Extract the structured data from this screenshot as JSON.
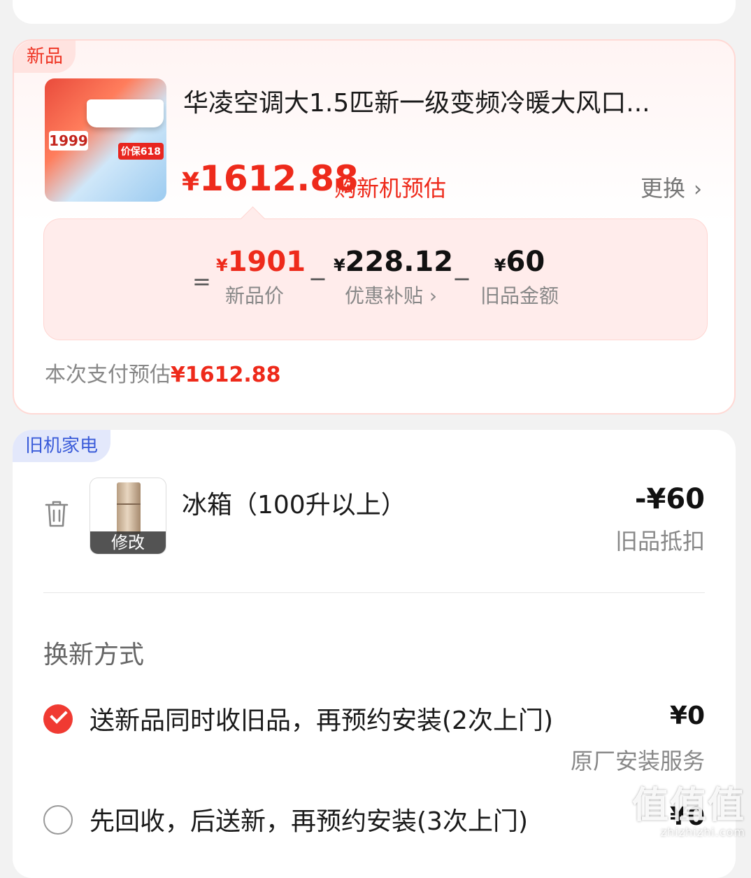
{
  "new_item": {
    "tag": "新品",
    "title": "华凌空调大1.5匹新一级变频冷暖大风口...",
    "thumb_price": "1999",
    "thumb_badge": "价保618",
    "price_yen": "¥",
    "price": "1612.88",
    "price_note": "购新机预估",
    "change_label": "更换",
    "calc": {
      "eq": "=",
      "minus": "−",
      "new_price_yen": "¥",
      "new_price": "1901",
      "new_price_label": "新品价",
      "subsidy_yen": "¥",
      "subsidy": "228.12",
      "subsidy_label": "优惠补贴",
      "subsidy_chevron": "›",
      "old_yen": "¥",
      "old_amount": "60",
      "old_label": "旧品金额"
    },
    "pay_estimate_label": "本次支付预估",
    "pay_estimate_value": "¥1612.88"
  },
  "old_item": {
    "tag": "旧机家电",
    "name": "冰箱（100升以上）",
    "edit_label": "修改",
    "deduction": "-¥60",
    "deduction_label": "旧品抵扣"
  },
  "method": {
    "title": "换新方式",
    "options": [
      {
        "label": "送新品同时收旧品，再预约安装(2次上门)",
        "price": "¥0",
        "sub": "原厂安装服务",
        "selected": true
      },
      {
        "label": "先回收，后送新，再预约安装(3次上门)",
        "price": "¥0",
        "selected": false
      }
    ]
  },
  "watermark": {
    "big": "值值值",
    "small": "zhizhizhi.com"
  },
  "colors": {
    "accent_red": "#ee2a1b",
    "tag_blue": "#3a5bd9"
  }
}
